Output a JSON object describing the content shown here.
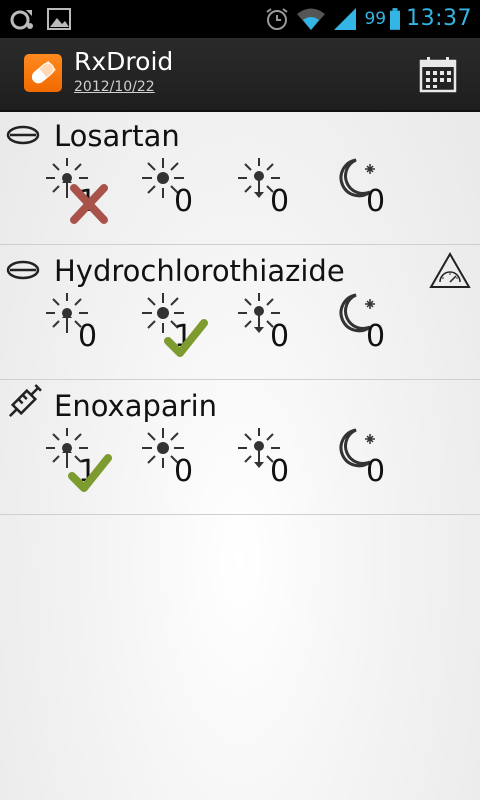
{
  "status_bar": {
    "battery_level": "99",
    "time": "13:37",
    "icons": [
      "notification-icon",
      "gallery-icon",
      "alarm-icon",
      "wifi-icon",
      "signal-icon",
      "battery-icon"
    ]
  },
  "action_bar": {
    "title": "RxDroid",
    "date": "2012/10/22",
    "calendar_button": "calendar-icon"
  },
  "drugs": [
    {
      "name": "Losartan",
      "icon": "tablet-icon",
      "warning": false,
      "doses": [
        {
          "time": "morning",
          "value": "1",
          "status": "missed"
        },
        {
          "time": "noon",
          "value": "0",
          "status": "none"
        },
        {
          "time": "evening",
          "value": "0",
          "status": "none"
        },
        {
          "time": "night",
          "value": "0",
          "status": "none"
        }
      ]
    },
    {
      "name": "Hydrochlorothiazide",
      "icon": "tablet-icon",
      "warning": true,
      "doses": [
        {
          "time": "morning",
          "value": "0",
          "status": "none"
        },
        {
          "time": "noon",
          "value": "1",
          "status": "taken"
        },
        {
          "time": "evening",
          "value": "0",
          "status": "none"
        },
        {
          "time": "night",
          "value": "0",
          "status": "none"
        }
      ]
    },
    {
      "name": "Enoxaparin",
      "icon": "syringe-icon",
      "warning": false,
      "doses": [
        {
          "time": "morning",
          "value": "1",
          "status": "taken"
        },
        {
          "time": "noon",
          "value": "0",
          "status": "none"
        },
        {
          "time": "evening",
          "value": "0",
          "status": "none"
        },
        {
          "time": "night",
          "value": "0",
          "status": "none"
        }
      ]
    }
  ],
  "colors": {
    "accent": "#33b5e5",
    "app_icon": "#f47a0f",
    "taken": "#7d9b2e",
    "missed": "#a8524a"
  }
}
